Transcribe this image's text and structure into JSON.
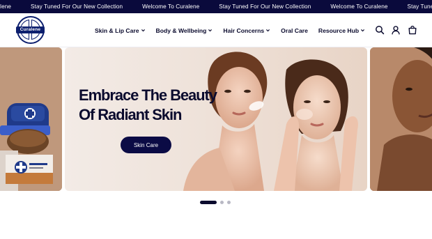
{
  "announcement": {
    "messages": [
      "Curalene",
      "Stay Tuned For Our New Collection",
      "Welcome To Curalene",
      "Stay Tuned For Our New Collection",
      "Welcome To Curalene",
      "Stay Tuned"
    ]
  },
  "brand": {
    "logo_text": "Curalene"
  },
  "nav": {
    "items": [
      {
        "label": "Skin & Lip Care",
        "has_dropdown": true
      },
      {
        "label": "Body & Wellbeing",
        "has_dropdown": true
      },
      {
        "label": "Hair Concerns",
        "has_dropdown": true
      },
      {
        "label": "Oral Care",
        "has_dropdown": false
      },
      {
        "label": "Resource Hub",
        "has_dropdown": true
      }
    ]
  },
  "header_icons": [
    "search-icon",
    "account-icon",
    "cart-icon"
  ],
  "hero": {
    "title": "Embrace The Beauty Of Radiant Skin",
    "button_label": "Skin Care"
  },
  "slider": {
    "slide_count": 3,
    "active_index": 0
  },
  "colors": {
    "navy": "#0a0a3c",
    "button": "#0b0b45",
    "text": "#0b0b2e"
  }
}
